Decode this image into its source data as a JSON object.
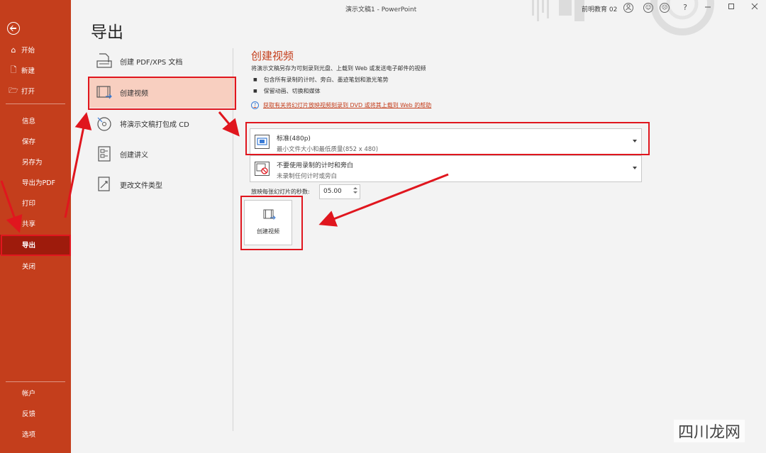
{
  "window": {
    "title": "演示文稿1  -  PowerPoint",
    "user": "前明教育 02",
    "help_glyph": "?"
  },
  "sidebar": {
    "top_items": [
      {
        "label": "开始",
        "icon": "home-icon"
      },
      {
        "label": "新建",
        "icon": "new-file-icon"
      },
      {
        "label": "打开",
        "icon": "folder-open-icon"
      }
    ],
    "middle_items": [
      {
        "label": "信息"
      },
      {
        "label": "保存"
      },
      {
        "label": "另存为"
      },
      {
        "label": "导出为PDF"
      },
      {
        "label": "打印"
      },
      {
        "label": "共享"
      },
      {
        "label": "导出"
      },
      {
        "label": "关闭"
      }
    ],
    "bottom_items": [
      {
        "label": "帐户"
      },
      {
        "label": "反馈"
      },
      {
        "label": "选项"
      }
    ],
    "active": "导出"
  },
  "main": {
    "title": "导出",
    "export_options": [
      {
        "label": "创建 PDF/XPS 文档",
        "icon": "pdf-document-icon"
      },
      {
        "label": "创建视频",
        "icon": "film-strip-icon",
        "selected": true
      },
      {
        "label": "将演示文稿打包成 CD",
        "icon": "cd-disc-icon"
      },
      {
        "label": "创建讲义",
        "icon": "handout-icon"
      },
      {
        "label": "更改文件类型",
        "icon": "change-filetype-icon"
      }
    ]
  },
  "video_panel": {
    "title": "创建视频",
    "description": "将演示文稿另存为可刻录到光盘、上载到 Web 或发送电子邮件的视频",
    "bullets": [
      "包含所有录制的计时、旁白、墨迹笔划和激光笔势",
      "保留动画、切换和媒体"
    ],
    "help_link": "获取有关将幻灯片放映视频刻录到 DVD 或将其上载到 Web 的帮助",
    "quality": {
      "title": "标准(480p)",
      "subtitle": "最小文件大小和最低质量(852 x 480)"
    },
    "timing": {
      "title": "不要使用录制的计时和旁白",
      "subtitle": "未录制任何计时或旁白"
    },
    "seconds_label": "放映每张幻灯片的秒数:",
    "seconds_value": "05.00",
    "create_button": "创建视频"
  },
  "watermark": "四川龙网",
  "colors": {
    "accent": "#c43e1c",
    "sidebar_active": "#9e1b0c",
    "selected_option": "#f8cfc0",
    "annotation": "#e0161e"
  }
}
